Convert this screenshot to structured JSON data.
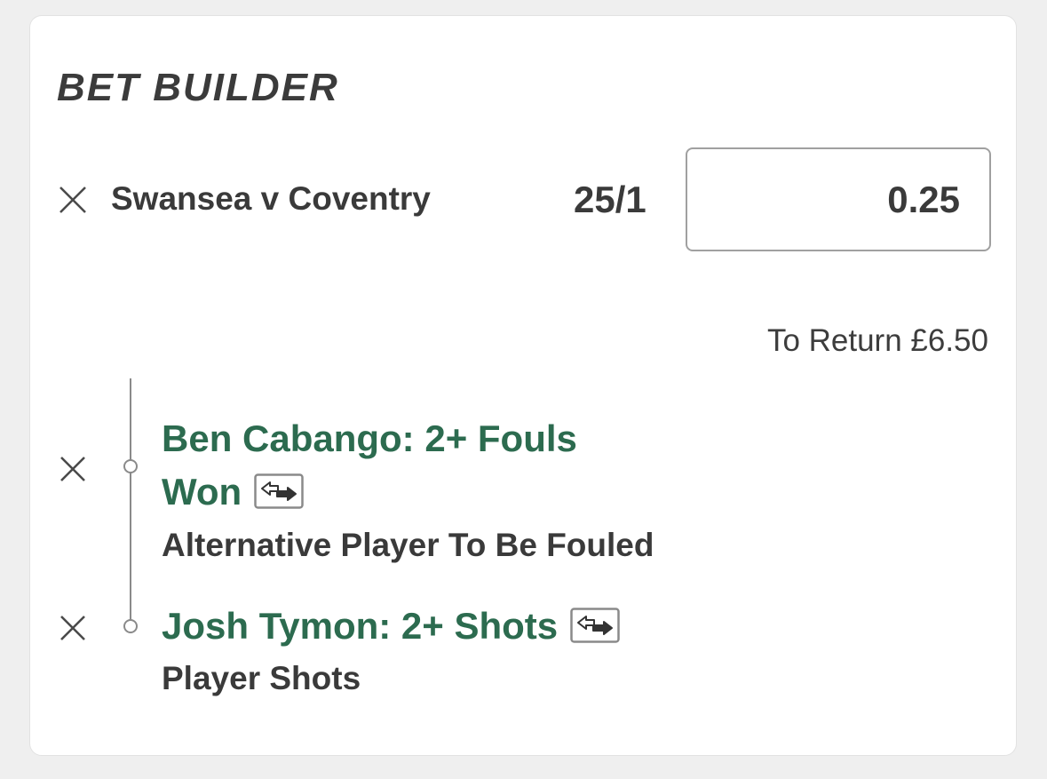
{
  "header": {
    "title": "BET BUILDER"
  },
  "bet": {
    "event": "Swansea v Coventry",
    "odds": "25/1",
    "stake": "0.25",
    "to_return": "To Return £6.50"
  },
  "selections": [
    {
      "title_line1": "Ben Cabango: 2+ Fouls",
      "title_line2": "Won",
      "market": "Alternative Player To Be Fouled"
    },
    {
      "title": "Josh Tymon: 2+ Shots",
      "market": "Player Shots"
    }
  ],
  "icons": {
    "remove": "close-icon",
    "swap": "swap-icon"
  },
  "colors": {
    "selection_green": "#2c6b4f",
    "text_dark": "#3a3a3a",
    "background": "#efefef"
  }
}
